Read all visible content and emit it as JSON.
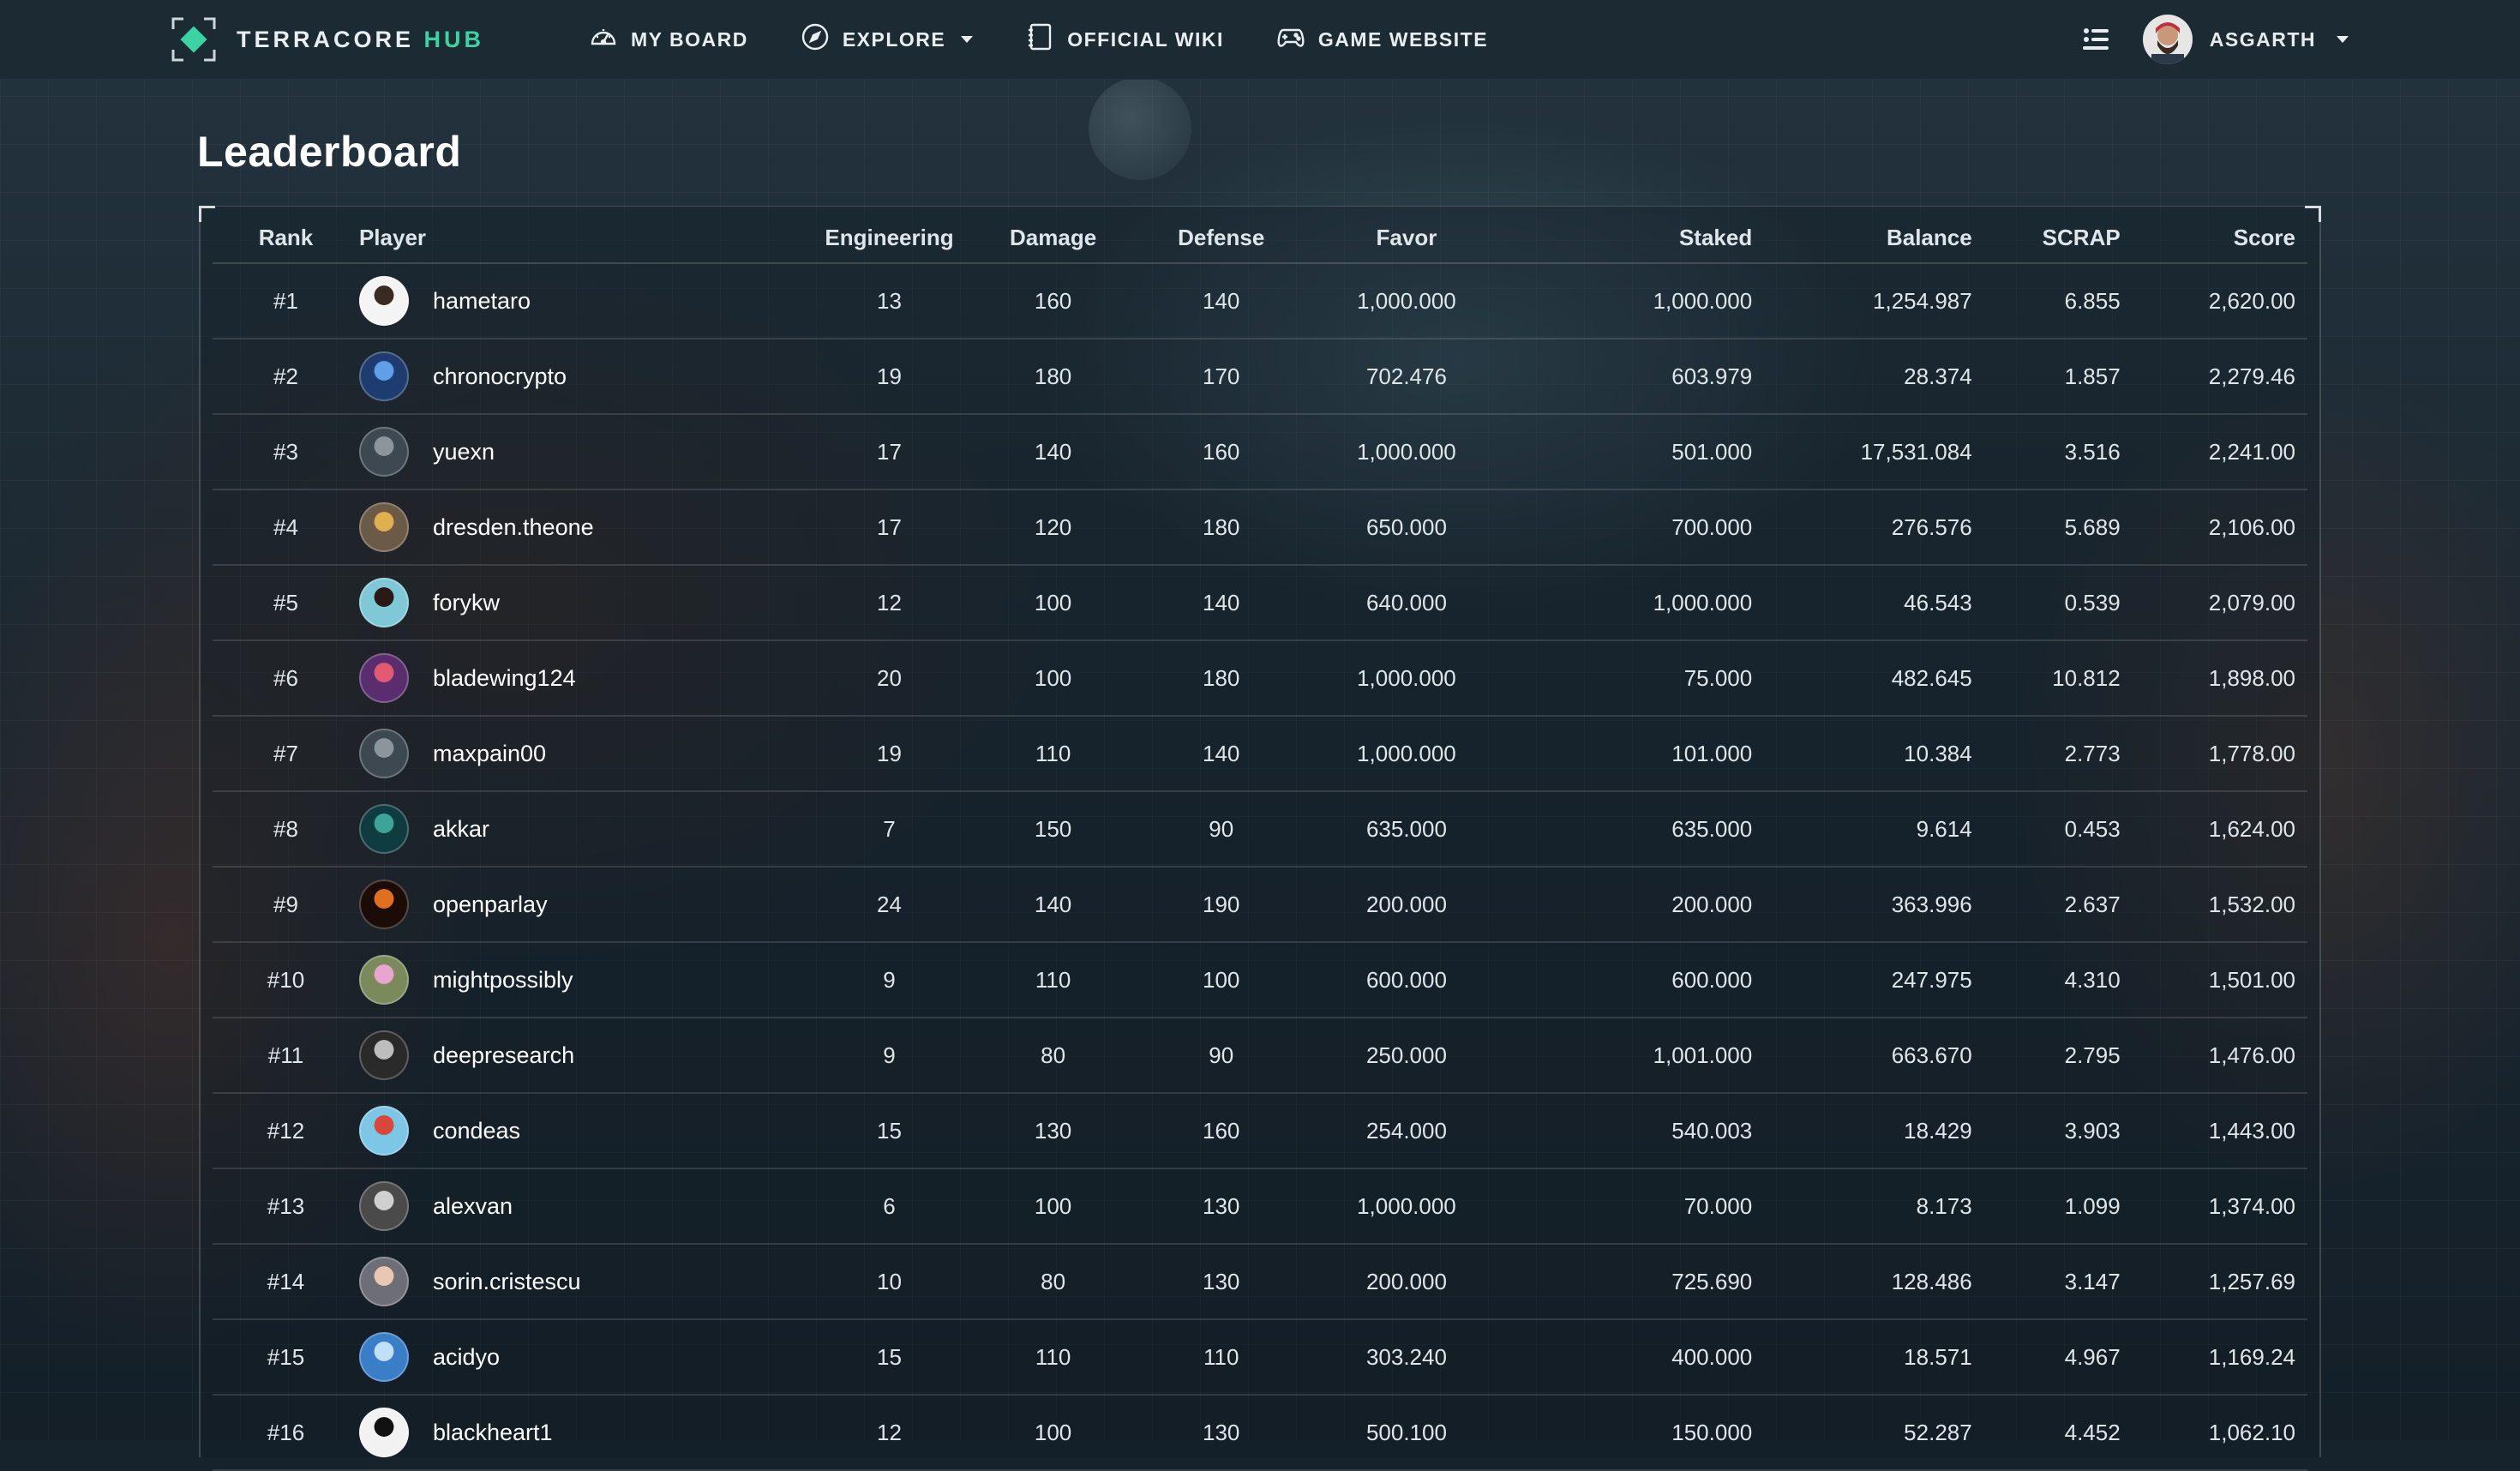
{
  "brand": {
    "name": "TERRACORE",
    "suffix": "HUB",
    "accent_color": "#3cd3a3"
  },
  "nav": {
    "links": [
      {
        "label": "MY BOARD",
        "icon": "gauge-icon"
      },
      {
        "label": "EXPLORE",
        "icon": "compass-icon",
        "dropdown": true
      },
      {
        "label": "OFFICIAL WIKI",
        "icon": "notebook-icon"
      },
      {
        "label": "GAME WEBSITE",
        "icon": "gamepad-icon"
      }
    ],
    "user": {
      "name": "ASGARTH"
    }
  },
  "page": {
    "title": "Leaderboard"
  },
  "table": {
    "columns": [
      "Rank",
      "Player",
      "Engineering",
      "Damage",
      "Defense",
      "Favor",
      "Staked",
      "Balance",
      "SCRAP",
      "Score"
    ],
    "rows": [
      {
        "rank": "#1",
        "player": "hametaro",
        "engineering": "13",
        "damage": "160",
        "defense": "140",
        "favor": "1,000.000",
        "staked": "1,000.000",
        "balance": "1,254.987",
        "scrap": "6.855",
        "score": "2,620.00",
        "avatar": [
          "#f4f4f4",
          "#3a2b22"
        ]
      },
      {
        "rank": "#2",
        "player": "chronocrypto",
        "engineering": "19",
        "damage": "180",
        "defense": "170",
        "favor": "702.476",
        "staked": "603.979",
        "balance": "28.374",
        "scrap": "1.857",
        "score": "2,279.46",
        "avatar": [
          "#1e3d6e",
          "#5fa0e8"
        ]
      },
      {
        "rank": "#3",
        "player": "yuexn",
        "engineering": "17",
        "damage": "140",
        "defense": "160",
        "favor": "1,000.000",
        "staked": "501.000",
        "balance": "17,531.084",
        "scrap": "3.516",
        "score": "2,241.00",
        "avatar": [
          "#3d4850",
          "#8c959c"
        ]
      },
      {
        "rank": "#4",
        "player": "dresden.theone",
        "engineering": "17",
        "damage": "120",
        "defense": "180",
        "favor": "650.000",
        "staked": "700.000",
        "balance": "276.576",
        "scrap": "5.689",
        "score": "2,106.00",
        "avatar": [
          "#6b5a45",
          "#e0b050"
        ]
      },
      {
        "rank": "#5",
        "player": "forykw",
        "engineering": "12",
        "damage": "100",
        "defense": "140",
        "favor": "640.000",
        "staked": "1,000.000",
        "balance": "46.543",
        "scrap": "0.539",
        "score": "2,079.00",
        "avatar": [
          "#7fc8d8",
          "#2a1a14"
        ]
      },
      {
        "rank": "#6",
        "player": "bladewing124",
        "engineering": "20",
        "damage": "100",
        "defense": "180",
        "favor": "1,000.000",
        "staked": "75.000",
        "balance": "482.645",
        "scrap": "10.812",
        "score": "1,898.00",
        "avatar": [
          "#5a2e6e",
          "#e05a70"
        ]
      },
      {
        "rank": "#7",
        "player": "maxpain00",
        "engineering": "19",
        "damage": "110",
        "defense": "140",
        "favor": "1,000.000",
        "staked": "101.000",
        "balance": "10.384",
        "scrap": "2.773",
        "score": "1,778.00",
        "avatar": [
          "#3d4850",
          "#8c959c"
        ]
      },
      {
        "rank": "#8",
        "player": "akkar",
        "engineering": "7",
        "damage": "150",
        "defense": "90",
        "favor": "635.000",
        "staked": "635.000",
        "balance": "9.614",
        "scrap": "0.453",
        "score": "1,624.00",
        "avatar": [
          "#0f3c40",
          "#3fa39a"
        ]
      },
      {
        "rank": "#9",
        "player": "openparlay",
        "engineering": "24",
        "damage": "140",
        "defense": "190",
        "favor": "200.000",
        "staked": "200.000",
        "balance": "363.996",
        "scrap": "2.637",
        "score": "1,532.00",
        "avatar": [
          "#1c0c08",
          "#e07020"
        ]
      },
      {
        "rank": "#10",
        "player": "mightpossibly",
        "engineering": "9",
        "damage": "110",
        "defense": "100",
        "favor": "600.000",
        "staked": "600.000",
        "balance": "247.975",
        "scrap": "4.310",
        "score": "1,501.00",
        "avatar": [
          "#7a8a5a",
          "#e6a6d0"
        ]
      },
      {
        "rank": "#11",
        "player": "deepresearch",
        "engineering": "9",
        "damage": "80",
        "defense": "90",
        "favor": "250.000",
        "staked": "1,001.000",
        "balance": "663.670",
        "scrap": "2.795",
        "score": "1,476.00",
        "avatar": [
          "#2a2a2a",
          "#bdbdbd"
        ]
      },
      {
        "rank": "#12",
        "player": "condeas",
        "engineering": "15",
        "damage": "130",
        "defense": "160",
        "favor": "254.000",
        "staked": "540.003",
        "balance": "18.429",
        "scrap": "3.903",
        "score": "1,443.00",
        "avatar": [
          "#7cc6e6",
          "#d8473a"
        ]
      },
      {
        "rank": "#13",
        "player": "alexvan",
        "engineering": "6",
        "damage": "100",
        "defense": "130",
        "favor": "1,000.000",
        "staked": "70.000",
        "balance": "8.173",
        "scrap": "1.099",
        "score": "1,374.00",
        "avatar": [
          "#4a4a4a",
          "#d0d0d0"
        ]
      },
      {
        "rank": "#14",
        "player": "sorin.cristescu",
        "engineering": "10",
        "damage": "80",
        "defense": "130",
        "favor": "200.000",
        "staked": "725.690",
        "balance": "128.486",
        "scrap": "3.147",
        "score": "1,257.69",
        "avatar": [
          "#6e6e78",
          "#e8c8b0"
        ]
      },
      {
        "rank": "#15",
        "player": "acidyo",
        "engineering": "15",
        "damage": "110",
        "defense": "110",
        "favor": "303.240",
        "staked": "400.000",
        "balance": "18.571",
        "scrap": "4.967",
        "score": "1,169.24",
        "avatar": [
          "#3a7ec8",
          "#bfe0f6"
        ]
      },
      {
        "rank": "#16",
        "player": "blackheart1",
        "engineering": "12",
        "damage": "100",
        "defense": "130",
        "favor": "500.100",
        "staked": "150.000",
        "balance": "52.287",
        "scrap": "4.452",
        "score": "1,062.10",
        "avatar": [
          "#f2f2f2",
          "#111111"
        ]
      }
    ]
  }
}
